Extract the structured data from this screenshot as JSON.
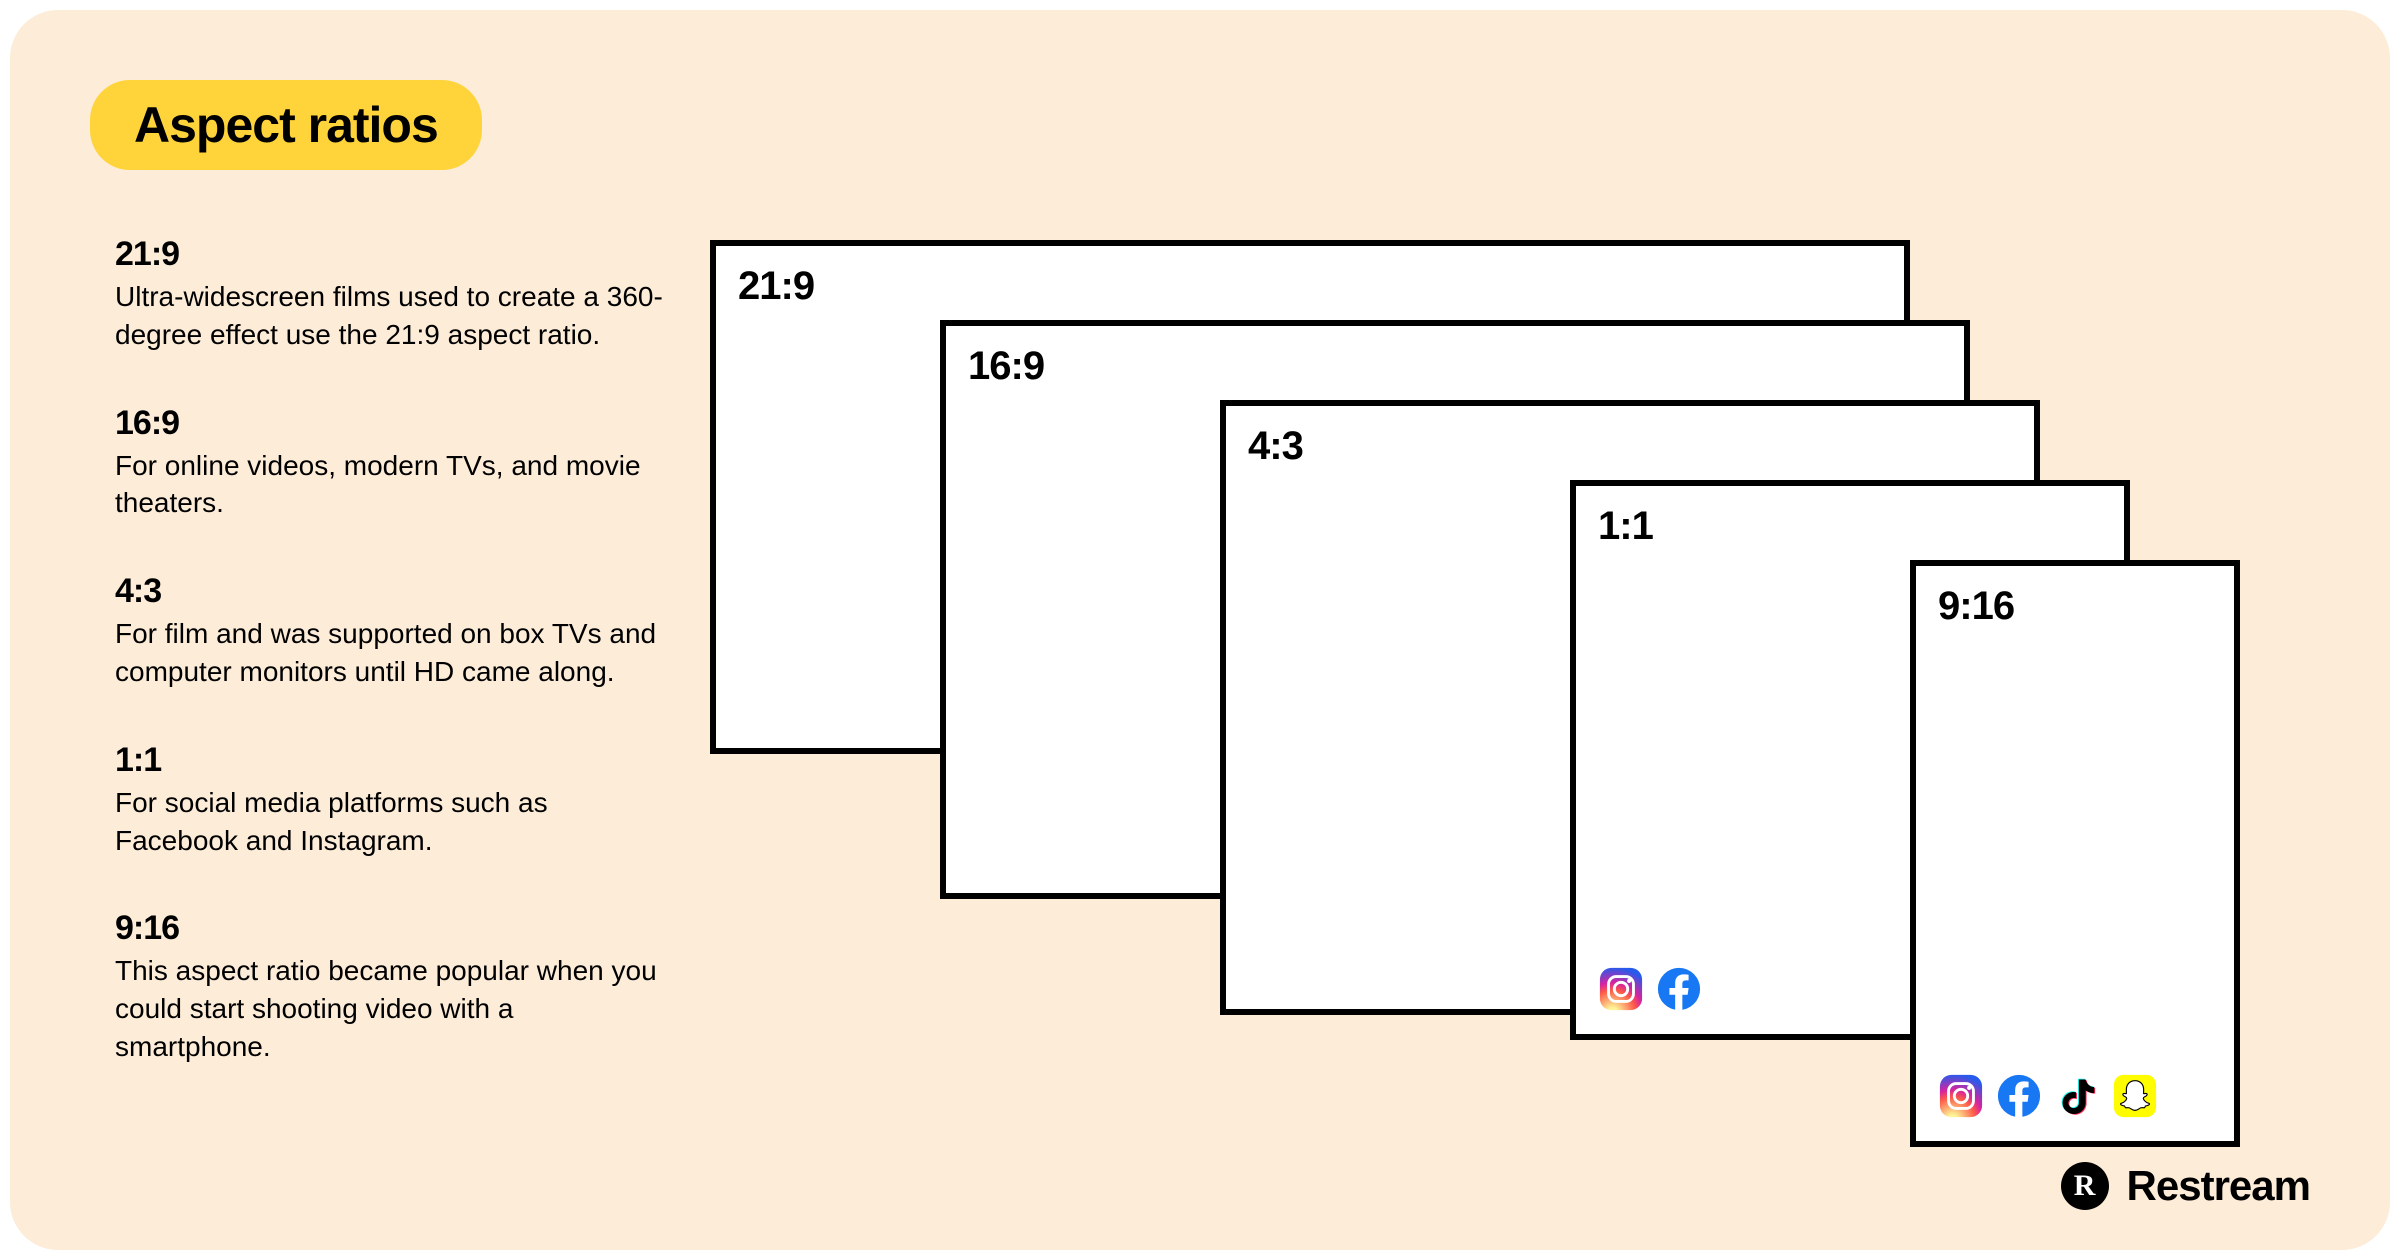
{
  "title": "Aspect ratios",
  "descriptions": [
    {
      "heading": "21:9",
      "body": "Ultra-widescreen films used to create a 360-degree effect use the 21:9 aspect ratio."
    },
    {
      "heading": "16:9",
      "body": "For online videos, modern TVs, and movie theaters."
    },
    {
      "heading": "4:3",
      "body": "For film and was supported on box TVs and computer monitors until HD came along."
    },
    {
      "heading": "1:1",
      "body": "For social media platforms such as Facebook and Instagram."
    },
    {
      "heading": "9:16",
      "body": "This aspect ratio became popular when you could start shooting video with a smartphone."
    }
  ],
  "boxes": {
    "r21_9": {
      "label": "21:9"
    },
    "r16_9": {
      "label": "16:9"
    },
    "r4_3": {
      "label": "4:3"
    },
    "r1_1": {
      "label": "1:1",
      "icons": [
        "instagram",
        "facebook"
      ]
    },
    "r9_16": {
      "label": "9:16",
      "icons": [
        "instagram",
        "facebook",
        "tiktok",
        "snapchat"
      ]
    }
  },
  "brand": {
    "badge_letter": "R",
    "text": "Restream"
  },
  "colors": {
    "bg": "#fcecd8",
    "highlight": "#ffd43b",
    "border": "#000000",
    "facebook": "#1877f2",
    "snapchat": "#fffc00",
    "tiktok_cyan": "#25f4ee",
    "tiktok_red": "#fe2c55"
  }
}
